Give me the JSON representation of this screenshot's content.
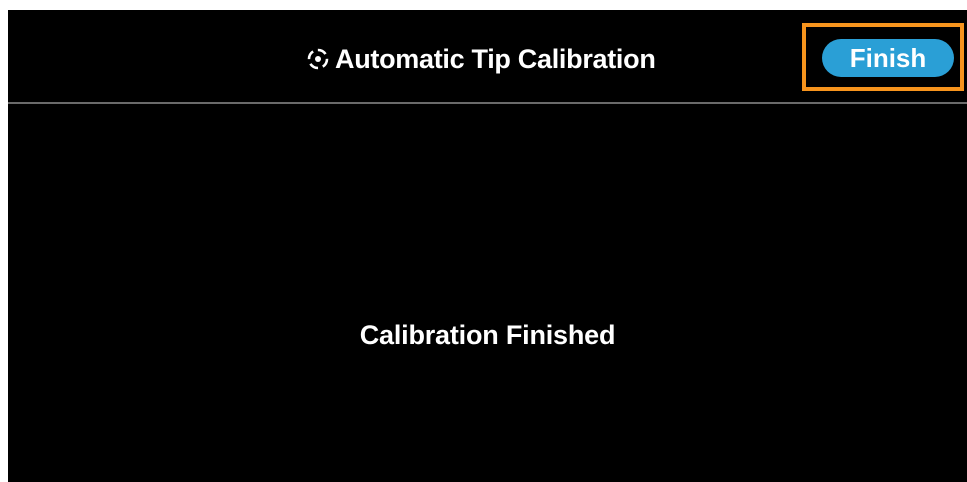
{
  "header": {
    "title": "Automatic Tip Calibration",
    "title_icon": "crosshair-target-icon",
    "finish_label": "Finish"
  },
  "main": {
    "status_message": "Calibration Finished"
  },
  "colors": {
    "background": "#000000",
    "accent_button": "#2a9fd6",
    "highlight_outline": "#f7941d",
    "text": "#ffffff"
  }
}
